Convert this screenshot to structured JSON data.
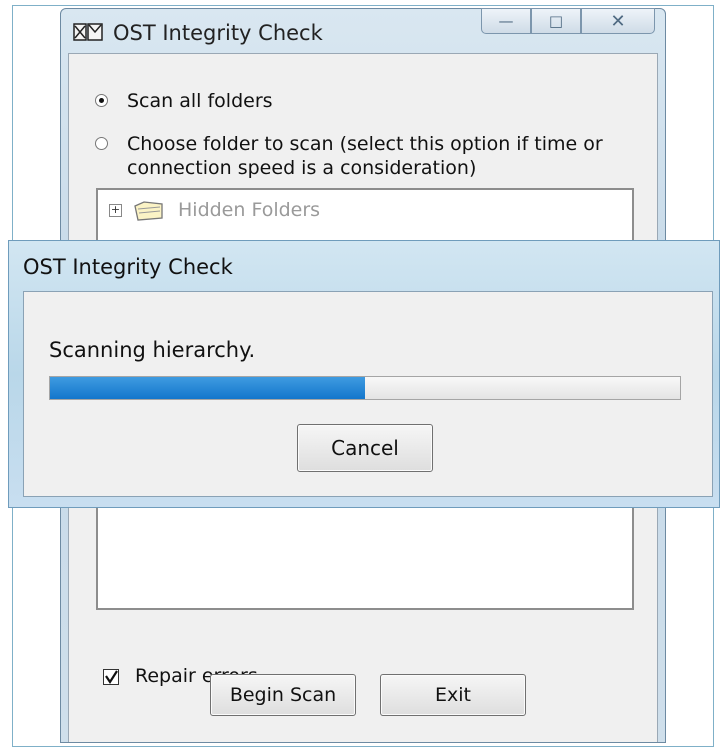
{
  "main_window": {
    "title": "OST Integrity Check",
    "controls": {
      "minimize_glyph": "—",
      "maximize_glyph": "□",
      "close_glyph": "✕"
    },
    "scan_all_label": "Scan all folders",
    "choose_folder_label_line1": "Choose folder to scan (select this option if time or",
    "choose_folder_label_line2": "connection speed is a consideration)",
    "scan_mode_selected": "scan_all",
    "folder_tree": {
      "items": [
        {
          "label": "Hidden Folders",
          "icon": "folder-icon",
          "expander": "+"
        }
      ]
    },
    "repair_errors_label": "Repair errors",
    "repair_errors_checked": true,
    "begin_scan_label": "Begin Scan",
    "exit_label": "Exit"
  },
  "progress_dialog": {
    "title": "OST Integrity Check",
    "status": "Scanning hierarchy.",
    "progress_fraction": 0.5,
    "cancel_label": "Cancel"
  },
  "colors": {
    "progress_fill": "#1376cc",
    "titlebar": "#c6d9e8",
    "client_bg": "#f0f0f0"
  }
}
